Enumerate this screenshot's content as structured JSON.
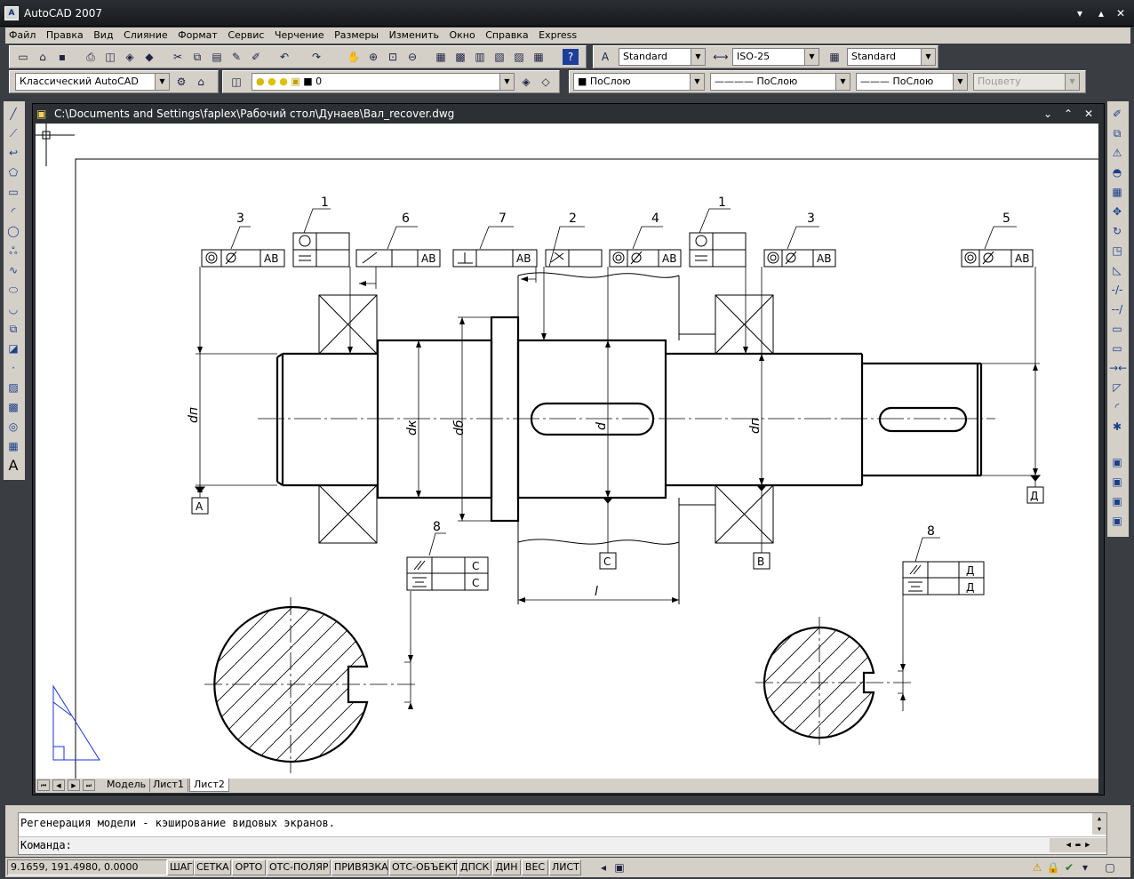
{
  "app": {
    "title": "AutoCAD 2007",
    "icon": "autocad-icon"
  },
  "menu": [
    "Файл",
    "Правка",
    "Вид",
    "Слияние",
    "Формат",
    "Сервис",
    "Черчение",
    "Размеры",
    "Изменить",
    "Окно",
    "Справка",
    "Express"
  ],
  "styles": {
    "text_style": "Standard",
    "dim_style": "ISO-25",
    "table_style": "Standard"
  },
  "workspace": {
    "name": "Классический AutoCAD"
  },
  "layer": {
    "name": "0",
    "color": "ПоСлою",
    "linetype": "ПоСлою",
    "lineweight": "ПоСлою",
    "plotstyle": "Поцвету"
  },
  "document": {
    "title": "C:\\Documents and Settings\\faplex\\Рабочий стол\\Дунаев\\Вал_recover.dwg"
  },
  "layout_tabs": [
    "Модель",
    "Лист1",
    "Лист2"
  ],
  "active_tab": "Лист2",
  "command": {
    "history": "Регенерация модели - кэширование видовых экранов.",
    "prompt": "Команда:"
  },
  "status": {
    "coords": "9.1659, 191.4980, 0.0000",
    "toggles": [
      "ШАГ",
      "СЕТКА",
      "ОРТО",
      "ОТС-ПОЛЯР",
      "ПРИВЯЗКА",
      "ОТС-ОБЪЕКТ",
      "ДПСК",
      "ДИН",
      "ВЕС",
      "ЛИСТ"
    ]
  },
  "drawing": {
    "leader_numbers": [
      "1",
      "6",
      "7",
      "2",
      "4",
      "1",
      "3",
      "5",
      "3",
      "8",
      "8"
    ],
    "fcf": {
      "ab": "AB",
      "c": "C",
      "d": "Д"
    },
    "datums": {
      "a": "A",
      "b": "B",
      "c": "C",
      "d": "Д"
    },
    "dims": {
      "dn": "dп",
      "dk": "dк",
      "db": "dб",
      "d": "d",
      "dn2": "dп",
      "l": "l"
    }
  },
  "colors": {
    "canvas": "#ffffff",
    "frame": "#3a3d42",
    "ucs": "#1a33d9"
  }
}
